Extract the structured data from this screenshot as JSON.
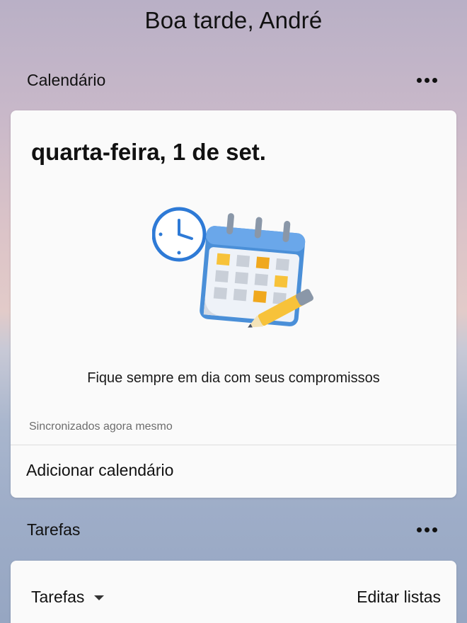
{
  "greeting": "Boa tarde, André",
  "calendar_section": {
    "title": "Calendário",
    "more_icon": "more-horizontal-icon"
  },
  "calendar_card": {
    "date": "quarta-feira, 1 de set.",
    "illustration": "calendar-clock-pencil-illustration",
    "message": "Fique sempre em dia com seus compromissos",
    "sync_status": "Sincronizados agora mesmo",
    "add_calendar_label": "Adicionar calendário"
  },
  "tasks_section": {
    "title": "Tarefas",
    "more_icon": "more-horizontal-icon"
  },
  "tasks_card": {
    "list_selector": "Tarefas",
    "caret_icon": "caret-down-icon",
    "edit_lists_label": "Editar listas"
  },
  "colors": {
    "card_background": "#fafafa",
    "accent_blue": "#4a8fd8",
    "accent_yellow": "#f7c23a"
  }
}
